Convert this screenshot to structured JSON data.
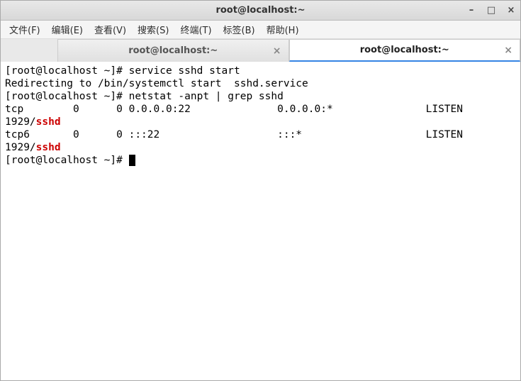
{
  "titlebar": {
    "title": "root@localhost:~"
  },
  "window_controls": {
    "minimize": "–",
    "maximize": "□",
    "close": "×"
  },
  "menubar": {
    "file": "文件(F)",
    "edit": "编辑(E)",
    "view": "查看(V)",
    "search": "搜索(S)",
    "terminal": "终端(T)",
    "tabs": "标签(B)",
    "help": "帮助(H)"
  },
  "tabs": {
    "tab1": {
      "label": "root@localhost:~",
      "close": "×"
    },
    "tab2": {
      "label": "root@localhost:~",
      "close": "×"
    }
  },
  "terminal_lines": {
    "l1_a": "[root@localhost ~]# service sshd start",
    "l2_a": "Redirecting to /bin/systemctl start  sshd.service",
    "l3_a": "[root@localhost ~]# netstat -anpt | grep sshd",
    "l4_a": "tcp        0      0 0.0.0.0:22              0.0.0.0:*               LISTEN     ",
    "l5_a": "1929/",
    "l5_b": "sshd",
    "l6_a": "tcp6       0      0 :::22                   :::*                    LISTEN     ",
    "l7_a": "1929/",
    "l7_b": "sshd",
    "l8_a": "[root@localhost ~]# "
  }
}
